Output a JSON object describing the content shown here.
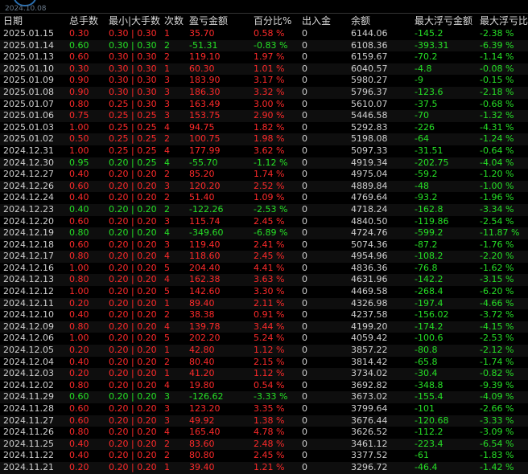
{
  "top": {
    "date": "2024.10.08"
  },
  "headers": [
    "日期",
    "总手数",
    "最小|大手数",
    "次数",
    "盈亏金额",
    "百分比%",
    "出入金",
    "余额",
    "最大浮亏金额",
    "最大浮亏比"
  ],
  "rows": [
    {
      "date": "2025.01.15",
      "lots": "0.30",
      "minmax": "0.30 | 0.30",
      "count": "1",
      "pnl": "35.70",
      "pct": "0.58 %",
      "io": "0",
      "bal": "6144.06",
      "mdd": "-145.2",
      "mddp": "-2.38 %",
      "pos": true
    },
    {
      "date": "2025.01.14",
      "lots": "0.60",
      "minmax": "0.30 | 0.30",
      "count": "2",
      "pnl": "-51.31",
      "pct": "-0.83 %",
      "io": "0",
      "bal": "6108.36",
      "mdd": "-393.31",
      "mddp": "-6.39 %",
      "pos": false
    },
    {
      "date": "2025.01.13",
      "lots": "0.60",
      "minmax": "0.30 | 0.30",
      "count": "2",
      "pnl": "119.10",
      "pct": "1.97 %",
      "io": "0",
      "bal": "6159.67",
      "mdd": "-70.2",
      "mddp": "-1.14 %",
      "pos": true
    },
    {
      "date": "2025.01.10",
      "lots": "0.30",
      "minmax": "0.30 | 0.30",
      "count": "1",
      "pnl": "60.30",
      "pct": "1.01 %",
      "io": "0",
      "bal": "6040.57",
      "mdd": "-4.8",
      "mddp": "-0.08 %",
      "pos": true
    },
    {
      "date": "2025.01.09",
      "lots": "0.90",
      "minmax": "0.30 | 0.30",
      "count": "3",
      "pnl": "183.90",
      "pct": "3.17 %",
      "io": "0",
      "bal": "5980.27",
      "mdd": "-9",
      "mddp": "-0.15 %",
      "pos": true
    },
    {
      "date": "2025.01.08",
      "lots": "0.90",
      "minmax": "0.30 | 0.30",
      "count": "3",
      "pnl": "186.30",
      "pct": "3.32 %",
      "io": "0",
      "bal": "5796.37",
      "mdd": "-123.6",
      "mddp": "-2.18 %",
      "pos": true
    },
    {
      "date": "2025.01.07",
      "lots": "0.80",
      "minmax": "0.25 | 0.30",
      "count": "3",
      "pnl": "163.49",
      "pct": "3.00 %",
      "io": "0",
      "bal": "5610.07",
      "mdd": "-37.5",
      "mddp": "-0.68 %",
      "pos": true
    },
    {
      "date": "2025.01.06",
      "lots": "0.75",
      "minmax": "0.25 | 0.25",
      "count": "3",
      "pnl": "153.75",
      "pct": "2.90 %",
      "io": "0",
      "bal": "5446.58",
      "mdd": "-70",
      "mddp": "-1.32 %",
      "pos": true
    },
    {
      "date": "2025.01.03",
      "lots": "1.00",
      "minmax": "0.25 | 0.25",
      "count": "4",
      "pnl": "94.75",
      "pct": "1.82 %",
      "io": "0",
      "bal": "5292.83",
      "mdd": "-226",
      "mddp": "-4.31 %",
      "pos": true
    },
    {
      "date": "2025.01.02",
      "lots": "0.50",
      "minmax": "0.25 | 0.25",
      "count": "2",
      "pnl": "100.75",
      "pct": "1.98 %",
      "io": "0",
      "bal": "5198.08",
      "mdd": "-64",
      "mddp": "-1.24 %",
      "pos": true
    },
    {
      "date": "2024.12.31",
      "lots": "1.00",
      "minmax": "0.25 | 0.25",
      "count": "4",
      "pnl": "177.99",
      "pct": "3.62 %",
      "io": "0",
      "bal": "5097.33",
      "mdd": "-31.51",
      "mddp": "-0.64 %",
      "pos": true
    },
    {
      "date": "2024.12.30",
      "lots": "0.95",
      "minmax": "0.20 | 0.25",
      "count": "4",
      "pnl": "-55.70",
      "pct": "-1.12 %",
      "io": "0",
      "bal": "4919.34",
      "mdd": "-202.75",
      "mddp": "-4.04 %",
      "pos": false
    },
    {
      "date": "2024.12.27",
      "lots": "0.40",
      "minmax": "0.20 | 0.20",
      "count": "2",
      "pnl": "85.20",
      "pct": "1.74 %",
      "io": "0",
      "bal": "4975.04",
      "mdd": "-59.2",
      "mddp": "-1.20 %",
      "pos": true
    },
    {
      "date": "2024.12.26",
      "lots": "0.60",
      "minmax": "0.20 | 0.20",
      "count": "3",
      "pnl": "120.20",
      "pct": "2.52 %",
      "io": "0",
      "bal": "4889.84",
      "mdd": "-48",
      "mddp": "-1.00 %",
      "pos": true
    },
    {
      "date": "2024.12.24",
      "lots": "0.40",
      "minmax": "0.20 | 0.20",
      "count": "2",
      "pnl": "51.40",
      "pct": "1.09 %",
      "io": "0",
      "bal": "4769.64",
      "mdd": "-93.2",
      "mddp": "-1.96 %",
      "pos": true
    },
    {
      "date": "2024.12.23",
      "lots": "0.40",
      "minmax": "0.20 | 0.20",
      "count": "2",
      "pnl": "-122.26",
      "pct": "-2.53 %",
      "io": "0",
      "bal": "4718.24",
      "mdd": "-162.8",
      "mddp": "-3.34 %",
      "pos": false
    },
    {
      "date": "2024.12.20",
      "lots": "0.60",
      "minmax": "0.20 | 0.20",
      "count": "3",
      "pnl": "115.74",
      "pct": "2.45 %",
      "io": "0",
      "bal": "4840.50",
      "mdd": "-119.86",
      "mddp": "-2.54 %",
      "pos": true
    },
    {
      "date": "2024.12.19",
      "lots": "0.80",
      "minmax": "0.20 | 0.20",
      "count": "4",
      "pnl": "-349.60",
      "pct": "-6.89 %",
      "io": "0",
      "bal": "4724.76",
      "mdd": "-599.2",
      "mddp": "-11.87 %",
      "pos": false
    },
    {
      "date": "2024.12.18",
      "lots": "0.60",
      "minmax": "0.20 | 0.20",
      "count": "3",
      "pnl": "119.40",
      "pct": "2.41 %",
      "io": "0",
      "bal": "5074.36",
      "mdd": "-87.2",
      "mddp": "-1.76 %",
      "pos": true
    },
    {
      "date": "2024.12.17",
      "lots": "0.80",
      "minmax": "0.20 | 0.20",
      "count": "4",
      "pnl": "118.60",
      "pct": "2.45 %",
      "io": "0",
      "bal": "4954.96",
      "mdd": "-108.2",
      "mddp": "-2.20 %",
      "pos": true
    },
    {
      "date": "2024.12.16",
      "lots": "1.00",
      "minmax": "0.20 | 0.20",
      "count": "5",
      "pnl": "204.40",
      "pct": "4.41 %",
      "io": "0",
      "bal": "4836.36",
      "mdd": "-76.8",
      "mddp": "-1.62 %",
      "pos": true
    },
    {
      "date": "2024.12.13",
      "lots": "0.80",
      "minmax": "0.20 | 0.20",
      "count": "4",
      "pnl": "162.38",
      "pct": "3.63 %",
      "io": "0",
      "bal": "4631.96",
      "mdd": "-142.2",
      "mddp": "-3.15 %",
      "pos": true
    },
    {
      "date": "2024.12.12",
      "lots": "1.00",
      "minmax": "0.20 | 0.20",
      "count": "5",
      "pnl": "142.60",
      "pct": "3.30 %",
      "io": "0",
      "bal": "4469.58",
      "mdd": "-268.4",
      "mddp": "-6.20 %",
      "pos": true
    },
    {
      "date": "2024.12.11",
      "lots": "0.20",
      "minmax": "0.20 | 0.20",
      "count": "1",
      "pnl": "89.40",
      "pct": "2.11 %",
      "io": "0",
      "bal": "4326.98",
      "mdd": "-197.4",
      "mddp": "-4.66 %",
      "pos": true
    },
    {
      "date": "2024.12.10",
      "lots": "0.40",
      "minmax": "0.20 | 0.20",
      "count": "2",
      "pnl": "38.38",
      "pct": "0.91 %",
      "io": "0",
      "bal": "4237.58",
      "mdd": "-156.02",
      "mddp": "-3.72 %",
      "pos": true
    },
    {
      "date": "2024.12.09",
      "lots": "0.80",
      "minmax": "0.20 | 0.20",
      "count": "4",
      "pnl": "139.78",
      "pct": "3.44 %",
      "io": "0",
      "bal": "4199.20",
      "mdd": "-174.2",
      "mddp": "-4.15 %",
      "pos": true
    },
    {
      "date": "2024.12.06",
      "lots": "1.00",
      "minmax": "0.20 | 0.20",
      "count": "5",
      "pnl": "202.20",
      "pct": "5.24 %",
      "io": "0",
      "bal": "4059.42",
      "mdd": "-100.6",
      "mddp": "-2.53 %",
      "pos": true
    },
    {
      "date": "2024.12.05",
      "lots": "0.20",
      "minmax": "0.20 | 0.20",
      "count": "1",
      "pnl": "42.80",
      "pct": "1.12 %",
      "io": "0",
      "bal": "3857.22",
      "mdd": "-80.8",
      "mddp": "-2.12 %",
      "pos": true
    },
    {
      "date": "2024.12.04",
      "lots": "0.40",
      "minmax": "0.20 | 0.20",
      "count": "2",
      "pnl": "80.40",
      "pct": "2.15 %",
      "io": "0",
      "bal": "3814.42",
      "mdd": "-65.8",
      "mddp": "-1.74 %",
      "pos": true
    },
    {
      "date": "2024.12.03",
      "lots": "0.20",
      "minmax": "0.20 | 0.20",
      "count": "1",
      "pnl": "41.20",
      "pct": "1.12 %",
      "io": "0",
      "bal": "3734.02",
      "mdd": "-30.4",
      "mddp": "-0.82 %",
      "pos": true
    },
    {
      "date": "2024.12.02",
      "lots": "0.80",
      "minmax": "0.20 | 0.20",
      "count": "4",
      "pnl": "19.80",
      "pct": "0.54 %",
      "io": "0",
      "bal": "3692.82",
      "mdd": "-348.8",
      "mddp": "-9.39 %",
      "pos": true
    },
    {
      "date": "2024.11.29",
      "lots": "0.60",
      "minmax": "0.20 | 0.20",
      "count": "3",
      "pnl": "-126.62",
      "pct": "-3.33 %",
      "io": "0",
      "bal": "3673.02",
      "mdd": "-155.4",
      "mddp": "-4.09 %",
      "pos": false
    },
    {
      "date": "2024.11.28",
      "lots": "0.60",
      "minmax": "0.20 | 0.20",
      "count": "3",
      "pnl": "123.20",
      "pct": "3.35 %",
      "io": "0",
      "bal": "3799.64",
      "mdd": "-101",
      "mddp": "-2.66 %",
      "pos": true
    },
    {
      "date": "2024.11.27",
      "lots": "0.60",
      "minmax": "0.20 | 0.20",
      "count": "3",
      "pnl": "49.92",
      "pct": "1.38 %",
      "io": "0",
      "bal": "3676.44",
      "mdd": "-120.68",
      "mddp": "-3.33 %",
      "pos": true
    },
    {
      "date": "2024.11.26",
      "lots": "0.80",
      "minmax": "0.20 | 0.20",
      "count": "4",
      "pnl": "165.40",
      "pct": "4.78 %",
      "io": "0",
      "bal": "3626.52",
      "mdd": "-112.2",
      "mddp": "-3.09 %",
      "pos": true
    },
    {
      "date": "2024.11.25",
      "lots": "0.40",
      "minmax": "0.20 | 0.20",
      "count": "2",
      "pnl": "83.60",
      "pct": "2.48 %",
      "io": "0",
      "bal": "3461.12",
      "mdd": "-223.4",
      "mddp": "-6.54 %",
      "pos": true
    },
    {
      "date": "2024.11.22",
      "lots": "0.40",
      "minmax": "0.20 | 0.20",
      "count": "2",
      "pnl": "80.80",
      "pct": "2.45 %",
      "io": "0",
      "bal": "3377.52",
      "mdd": "-61",
      "mddp": "-1.83 %",
      "pos": true
    },
    {
      "date": "2024.11.21",
      "lots": "0.20",
      "minmax": "0.20 | 0.20",
      "count": "1",
      "pnl": "39.40",
      "pct": "1.21 %",
      "io": "0",
      "bal": "3296.72",
      "mdd": "-46.4",
      "mddp": "-1.42 %",
      "pos": true
    }
  ]
}
